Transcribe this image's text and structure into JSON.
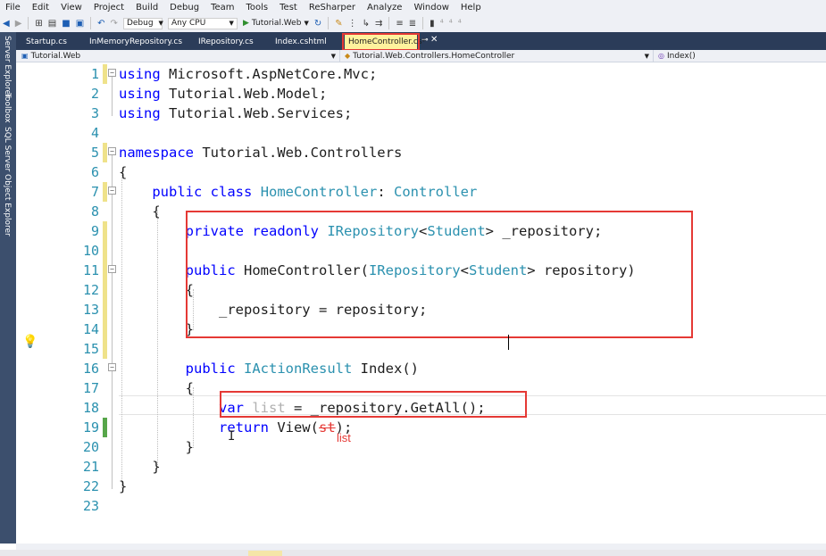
{
  "menu": [
    "File",
    "Edit",
    "View",
    "Project",
    "Build",
    "Debug",
    "Team",
    "Tools",
    "Test",
    "ReSharper",
    "Analyze",
    "Window",
    "Help"
  ],
  "toolbar": {
    "config": "Debug",
    "platform": "Any CPU",
    "run_target": "Tutorial.Web"
  },
  "left_dock": {
    "tabs": [
      "Server Explorer",
      "Toolbox",
      "SQL Server Object Explorer"
    ]
  },
  "tabs": [
    {
      "label": "Startup.cs"
    },
    {
      "label": "InMemoryRepository.cs"
    },
    {
      "label": "IRepository.cs"
    },
    {
      "label": "Index.cshtml"
    },
    {
      "label": "HomeController.cs*",
      "active": true
    }
  ],
  "navbar": {
    "project": "Tutorial.Web",
    "type": "Tutorial.Web.Controllers.HomeController",
    "member": "Index()"
  },
  "code_lines": [
    {
      "n": "1",
      "change": "yellow",
      "fold": "minus",
      "html": "<span class=\"kw\">using</span> Microsoft.AspNetCore.Mvc;"
    },
    {
      "n": "2",
      "change": "",
      "fold": "",
      "html": "<span class=\"kw\">using</span> Tutorial.Web.Model;"
    },
    {
      "n": "3",
      "change": "",
      "fold": "",
      "html": "<span class=\"kw\">using</span> Tutorial.Web.Services;"
    },
    {
      "n": "4",
      "change": "",
      "fold": "",
      "html": ""
    },
    {
      "n": "5",
      "change": "yellow",
      "fold": "minus",
      "html": "<span class=\"kw\">namespace</span> Tutorial.Web.Controllers"
    },
    {
      "n": "6",
      "change": "",
      "fold": "",
      "html": "{"
    },
    {
      "n": "7",
      "change": "yellow",
      "fold": "minus",
      "html": "    <span class=\"kw\">public</span> <span class=\"kw\">class</span> <span class=\"ty\">HomeController</span>: <span class=\"ty\">Controller</span>"
    },
    {
      "n": "8",
      "change": "",
      "fold": "",
      "html": "    {"
    },
    {
      "n": "9",
      "change": "yellow",
      "fold": "",
      "html": "        <span class=\"kw\">private</span> <span class=\"kw\">readonly</span> <span class=\"ty\">IRepository</span>&lt;<span class=\"ty\">Student</span>&gt; _repository;"
    },
    {
      "n": "10",
      "change": "yellow",
      "fold": "",
      "html": ""
    },
    {
      "n": "11",
      "change": "yellow",
      "fold": "minus",
      "html": "        <span class=\"kw\">public</span> HomeController(<span class=\"ty\">IRepository</span>&lt;<span class=\"ty\">Student</span>&gt; repository)"
    },
    {
      "n": "12",
      "change": "yellow",
      "fold": "",
      "html": "        {"
    },
    {
      "n": "13",
      "change": "yellow",
      "fold": "",
      "html": "            _repository = repository;"
    },
    {
      "n": "14",
      "change": "yellow",
      "fold": "",
      "html": "        }"
    },
    {
      "n": "15",
      "change": "yellow",
      "fold": "",
      "html": ""
    },
    {
      "n": "16",
      "change": "",
      "fold": "minus",
      "html": "        <span class=\"kw\">public</span> <span class=\"ty\">IActionResult</span> Index()"
    },
    {
      "n": "17",
      "change": "",
      "fold": "",
      "html": "        {"
    },
    {
      "n": "18",
      "change": "",
      "fold": "",
      "html": "            <span class=\"kw\">var</span> <span class=\"dim\">list</span> = _repository.GetAll();"
    },
    {
      "n": "19",
      "change": "green",
      "fold": "",
      "html": "            <span class=\"kw\">return</span> View(<span class=\"strike\">st</span>);"
    },
    {
      "n": "20",
      "change": "",
      "fold": "",
      "html": "        }"
    },
    {
      "n": "21",
      "change": "",
      "fold": "",
      "html": "    }"
    },
    {
      "n": "22",
      "change": "",
      "fold": "",
      "html": "}"
    },
    {
      "n": "23",
      "change": "",
      "fold": "",
      "html": ""
    }
  ],
  "annotation": {
    "replacement": "list"
  },
  "colors": {
    "accent_red": "#e53935",
    "change_saved": "#57a64a",
    "change_unsaved": "#efe28a",
    "keyword": "#0000ff",
    "type": "#2b91af"
  }
}
